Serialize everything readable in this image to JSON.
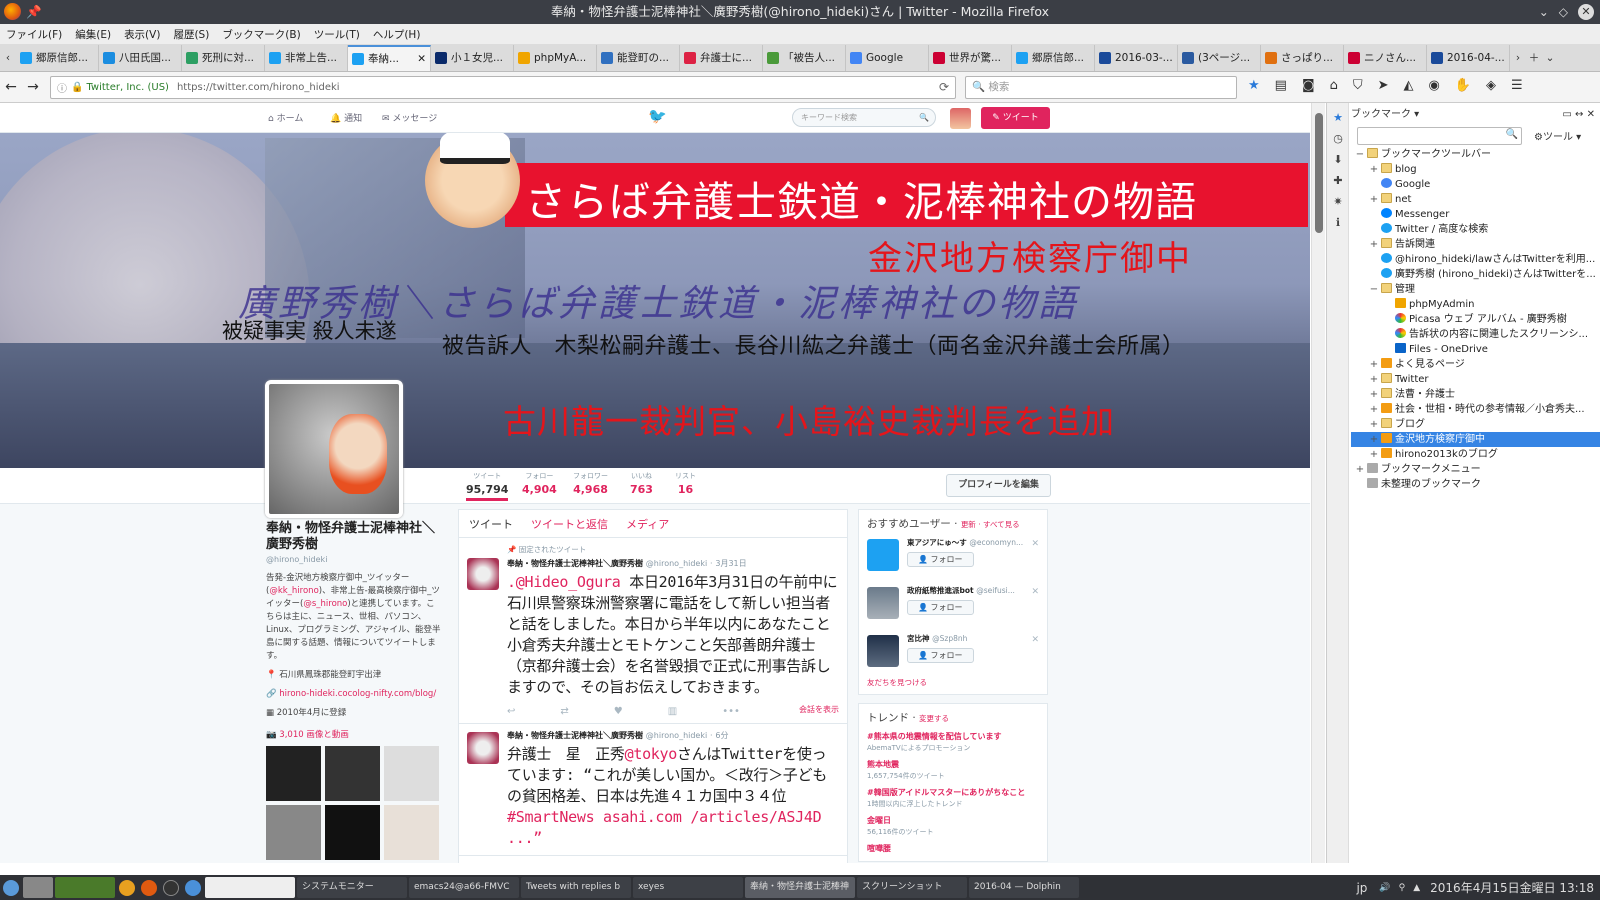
{
  "window": {
    "title": "奉納・物怪弁護士泥棒神社＼廣野秀樹(@hirono_hideki)さん | Twitter - Mozilla Firefox"
  },
  "menu": [
    "ファイル(F)",
    "編集(E)",
    "表示(V)",
    "履歴(S)",
    "ブックマーク(B)",
    "ツール(T)",
    "ヘルプ(H)"
  ],
  "tabs": [
    {
      "label": "郷原信郎...",
      "color": "#1da1f2"
    },
    {
      "label": "八田氏国...",
      "color": "#1b8de0"
    },
    {
      "label": "死刑に対...",
      "color": "#2d9f63"
    },
    {
      "label": "非常上告...",
      "color": "#1da1f2"
    },
    {
      "label": "奉納...",
      "color": "#1da1f2",
      "active": true
    },
    {
      "label": "小１女児...",
      "color": "#0a2a6a"
    },
    {
      "label": "phpMyA...",
      "color": "#f0a500"
    },
    {
      "label": "能登町の...",
      "color": "#3070c0"
    },
    {
      "label": "弁護士に...",
      "color": "#dd2244"
    },
    {
      "label": "「被告人...",
      "color": "#4a9a3a"
    },
    {
      "label": "Google",
      "color": "#4285f4"
    },
    {
      "label": "世界が驚...",
      "color": "#cc0033"
    },
    {
      "label": "郷原信郎...",
      "color": "#1da1f2"
    },
    {
      "label": "2016-03-...",
      "color": "#1a4a9a"
    },
    {
      "label": "(3ページ...",
      "color": "#2a5aa0"
    },
    {
      "label": "さっぱり...",
      "color": "#e07010"
    },
    {
      "label": "ニノさん...",
      "color": "#cc0033"
    },
    {
      "label": "2016-04-...",
      "color": "#1a4a9a"
    }
  ],
  "nav": {
    "org": "Twitter, Inc. (US)",
    "url": "https://twitter.com/hirono_hideki",
    "search_placeholder": "検索"
  },
  "twitter": {
    "nav_home": "ホーム",
    "nav_notify": "通知",
    "nav_messages": "メッセージ",
    "search_placeholder": "キーワード検索",
    "tweet_button": "ツイート",
    "banner": {
      "title": "さらば弁護士鉄道・泥棒神社の物語",
      "line_red": "金沢地方検察庁御中",
      "line_script": "廣野秀樹＼さらば弁護士鉄道・泥棒神社の物語",
      "suspect": "被疑事実 殺人未遂",
      "accused": "被告訴人　木梨松嗣弁護士、長谷川紘之弁護士（両名金沢弁護士会所属）",
      "added": "古川龍一裁判官、小島裕史裁判長を追加"
    },
    "stats": [
      {
        "label": "ツイート",
        "value": "95,794"
      },
      {
        "label": "フォロー",
        "value": "4,904"
      },
      {
        "label": "フォロワー",
        "value": "4,968"
      },
      {
        "label": "いいね",
        "value": "763"
      },
      {
        "label": "リスト",
        "value": "16"
      }
    ],
    "edit_profile": "プロフィールを編集",
    "profile": {
      "name": "奉納・物怪弁護士泥棒神社＼廣野秀樹",
      "handle": "@hirono_hideki",
      "bio_1": "告発-金沢地方検察庁御中_ツイッター(",
      "bio_link1": "@kk_hirono",
      "bio_2": ")、非常上告-最高検察庁御中_ツイッター(",
      "bio_link2": "@s_hirono",
      "bio_3": ")と連携しています。こちらは主に、ニュース、世相、パソコン、Linux、プログラミング、アジャイル、能登半島に関する話題、情報についてツイートします。",
      "location": "石川県鳳珠郡能登町宇出津",
      "site": "hirono-hideki.cocolog-nifty.com/blog/",
      "joined": "2010年4月に登録",
      "media": "3,010 画像と動画"
    },
    "timeline_tabs": [
      "ツイート",
      "ツイートと返信",
      "メディア"
    ],
    "tweet1": {
      "pinned": "固定されたツイート",
      "author": "奉納・物怪弁護士泥棒神社＼廣野秀樹",
      "handle": "@hirono_hideki",
      "time": "3月31日",
      "mention": ".@Hideo_Ogura",
      "text": " 本日2016年3月31日の午前中に石川県警察珠洲警察署に電話をして新しい担当者と話をしました。本日から半年以内にあなたこと小倉秀夫弁護士とモトケンこと矢部善朗弁護士（京都弁護士会）を名誉毀損で正式に刑事告訴しますので、その旨お伝えしておきます。",
      "conversation": "会話を表示"
    },
    "tweet2": {
      "author": "奉納・物怪弁護士泥棒神社＼廣野秀樹",
      "handle": "@hirono_hideki",
      "time": "6分",
      "text_1": "弁護士　星　正秀",
      "mention": "@tokyo",
      "text_2": "さんはTwitterを使っています: “これが美しい国か。＜改行＞子どもの貧困格差、日本は先進４１カ国中３４位 ",
      "hashtag": "#SmartNews asahi.com /articles/ASJ4D ...”"
    },
    "recommend": {
      "title": "おすすめユーザー",
      "refresh": "更新 · すべて見る",
      "users": [
        {
          "name": "東アジアにゅ～す",
          "handle": "@economyn..."
        },
        {
          "name": "政府紙幣推進派bot",
          "handle": "@seifusi..."
        },
        {
          "name": "宮比神",
          "handle": "@Szp8nh"
        }
      ],
      "follow": "フォロー",
      "find_friends": "友だちを見つける"
    },
    "trends": {
      "title": "トレンド",
      "change": "変更する",
      "items": [
        {
          "name": "#熊本県の地震情報を配信しています",
          "count": "AbemaTVによるプロモーション"
        },
        {
          "name": "熊本地震",
          "count": "1,657,754件のツイート"
        },
        {
          "name": "#韓国版アイドルマスターにありがちなこと",
          "count": "1時間以内に浮上したトレンド"
        },
        {
          "name": "金曜日",
          "count": "56,116件のツイート"
        },
        {
          "name": "喧嘩腰",
          "count": ""
        }
      ]
    }
  },
  "sidebar": {
    "title": "ブックマーク",
    "tools": "ツール",
    "tree": [
      {
        "label": "ブックマークツールバー",
        "exp": "−",
        "icon": "folder",
        "indent": 0
      },
      {
        "label": "blog",
        "exp": "+",
        "icon": "folder",
        "indent": 1
      },
      {
        "label": "Google",
        "exp": "",
        "icon": "g",
        "indent": 1
      },
      {
        "label": "net",
        "exp": "+",
        "icon": "folder",
        "indent": 1
      },
      {
        "label": "Messenger",
        "exp": "",
        "icon": "msg",
        "indent": 1
      },
      {
        "label": "Twitter / 高度な検索",
        "exp": "",
        "icon": "tw",
        "indent": 1
      },
      {
        "label": "告訴関連",
        "exp": "+",
        "icon": "folder",
        "indent": 1
      },
      {
        "label": "@hirono_hideki/lawさんはTwitterを利用...",
        "exp": "",
        "icon": "tw",
        "indent": 1
      },
      {
        "label": "廣野秀樹 (hirono_hideki)さんはTwitterを...",
        "exp": "",
        "icon": "tw",
        "indent": 1
      },
      {
        "label": "管理",
        "exp": "−",
        "icon": "folder",
        "indent": 1
      },
      {
        "label": "phpMyAdmin",
        "exp": "",
        "icon": "pma",
        "indent": 2
      },
      {
        "label": "Picasa ウェブ アルバム - 廣野秀樹",
        "exp": "",
        "icon": "pic",
        "indent": 2
      },
      {
        "label": "告訴状の内容に関連したスクリーンシ...",
        "exp": "",
        "icon": "pic",
        "indent": 2
      },
      {
        "label": "Files - OneDrive",
        "exp": "",
        "icon": "od",
        "indent": 2
      },
      {
        "label": "よく見るページ",
        "exp": "+",
        "icon": "rss",
        "indent": 1
      },
      {
        "label": "Twitter",
        "exp": "+",
        "icon": "folder",
        "indent": 1
      },
      {
        "label": "法曹・弁護士",
        "exp": "+",
        "icon": "folder",
        "indent": 1
      },
      {
        "label": "社会・世相・時代の参考情報／小倉秀夫...",
        "exp": "+",
        "icon": "rss",
        "indent": 1
      },
      {
        "label": "ブログ",
        "exp": "+",
        "icon": "folder",
        "indent": 1
      },
      {
        "label": "金沢地方検察庁御中",
        "exp": "+",
        "icon": "rss",
        "indent": 1,
        "selected": true
      },
      {
        "label": "hirono2013kのブログ",
        "exp": "+",
        "icon": "rss",
        "indent": 1
      },
      {
        "label": "ブックマークメニュー",
        "exp": "+",
        "icon": "bm",
        "indent": 0
      },
      {
        "label": "未整理のブックマーク",
        "exp": "",
        "icon": "bm",
        "indent": 0
      }
    ]
  },
  "taskbar": {
    "items": [
      "システムモニター",
      "emacs24@a66-FMVC",
      "Tweets with replies b",
      "xeyes",
      "奉納・物怪弁護士泥棒神",
      "スクリーンショット",
      "2016-04 — Dolphin"
    ],
    "lang": "jp",
    "clock": "2016年4月15日金曜日 13:18"
  }
}
